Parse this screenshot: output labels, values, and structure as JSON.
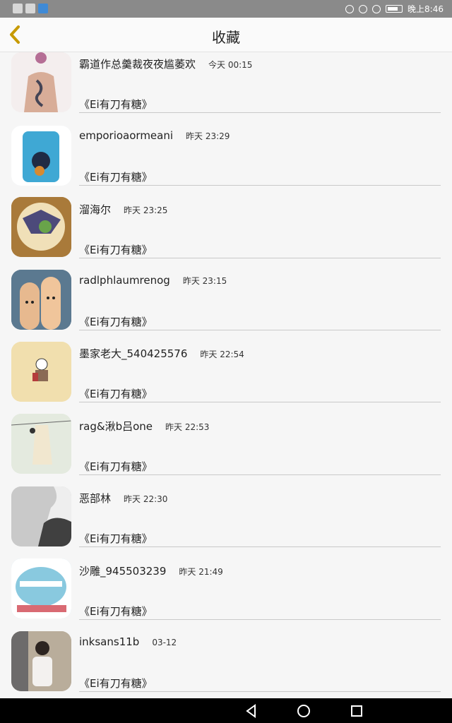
{
  "status_bar": {
    "time": "晚上8:46"
  },
  "header": {
    "title": "收藏"
  },
  "items": [
    {
      "name": "霸道作总羹裁夜夜尴萎欢",
      "time": "今天 00:15",
      "subtitle": "《Ei有刀有糖》",
      "avatar_color": "#efe8e5"
    },
    {
      "name": "emporioaormeani",
      "time": "昨天 23:29",
      "subtitle": "《Ei有刀有糖》",
      "avatar_color": "#e9f5fb"
    },
    {
      "name": "溜海尔",
      "time": "昨天 23:25",
      "subtitle": "《Ei有刀有糖》",
      "avatar_color": "#a97a3a"
    },
    {
      "name": "radlphlaumrenog",
      "time": "昨天 23:15",
      "subtitle": "《Ei有刀有糖》",
      "avatar_color": "#5b7990"
    },
    {
      "name": "墨家老大_540425576",
      "time": "昨天 22:54",
      "subtitle": "《Ei有刀有糖》",
      "avatar_color": "#f1dfae"
    },
    {
      "name": "rag&湫b吕one",
      "time": "昨天 22:53",
      "subtitle": "《Ei有刀有糖》",
      "avatar_color": "#e4eadf"
    },
    {
      "name": "恶部林",
      "time": "昨天 22:30",
      "subtitle": "《Ei有刀有糖》",
      "avatar_color": "#c6c6c6"
    },
    {
      "name": "沙雕_945503239",
      "time": "昨天 21:49",
      "subtitle": "《Ei有刀有糖》",
      "avatar_color": "#a9d5e8"
    },
    {
      "name": "inksans11b",
      "time": "03-12",
      "subtitle": "《Ei有刀有糖》",
      "avatar_color": "#b9ad9b"
    }
  ],
  "colors": {
    "accent": "#c79a00",
    "status_bar": "#8a8a8a",
    "nav_bar": "#000000"
  },
  "icons": {
    "back": "chevron-left-icon",
    "nav_back": "triangle-back-icon",
    "nav_home": "circle-home-icon",
    "nav_recents": "square-recents-icon"
  }
}
